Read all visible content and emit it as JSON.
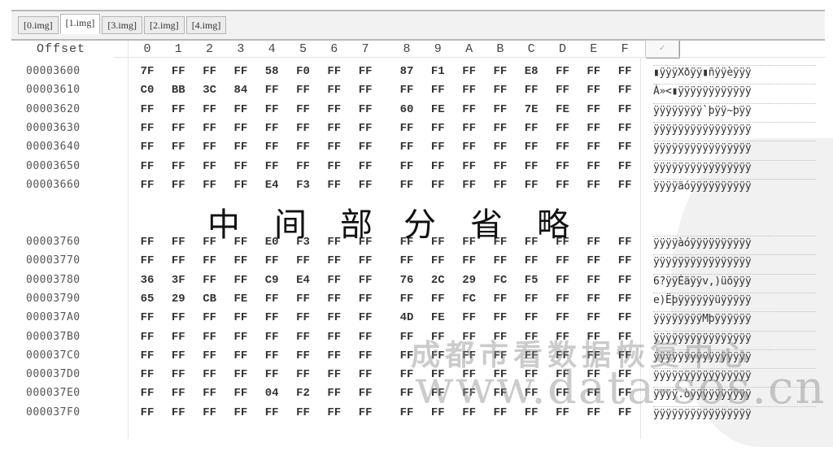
{
  "tabs": [
    {
      "label": "[0.img]",
      "active": false
    },
    {
      "label": "[1.img]",
      "active": true
    },
    {
      "label": "[3.img]",
      "active": false
    },
    {
      "label": "[2.img]",
      "active": false
    },
    {
      "label": "[4.img]",
      "active": false
    }
  ],
  "header": {
    "offset_label": "Offset",
    "columns": [
      "0",
      "1",
      "2",
      "3",
      "4",
      "5",
      "6",
      "7",
      "8",
      "9",
      "A",
      "B",
      "C",
      "D",
      "E",
      "F"
    ],
    "corner_button": "✓"
  },
  "rows_top": [
    {
      "offset": "00003600",
      "bytes": [
        "7F",
        "FF",
        "FF",
        "FF",
        "58",
        "F0",
        "FF",
        "FF",
        "87",
        "F1",
        "FF",
        "FF",
        "E8",
        "FF",
        "FF",
        "FF"
      ],
      "ascii": "▮ÿÿÿXðÿÿ▮ñÿÿèÿÿÿ"
    },
    {
      "offset": "00003610",
      "bytes": [
        "C0",
        "BB",
        "3C",
        "84",
        "FF",
        "FF",
        "FF",
        "FF",
        "FF",
        "FF",
        "FF",
        "FF",
        "FF",
        "FF",
        "FF",
        "FF"
      ],
      "ascii": "À»<▮ÿÿÿÿÿÿÿÿÿÿÿÿ"
    },
    {
      "offset": "00003620",
      "bytes": [
        "FF",
        "FF",
        "FF",
        "FF",
        "FF",
        "FF",
        "FF",
        "FF",
        "60",
        "FE",
        "FF",
        "FF",
        "7E",
        "FE",
        "FF",
        "FF"
      ],
      "ascii": "ÿÿÿÿÿÿÿÿ`þÿÿ~þÿÿ"
    },
    {
      "offset": "00003630",
      "bytes": [
        "FF",
        "FF",
        "FF",
        "FF",
        "FF",
        "FF",
        "FF",
        "FF",
        "FF",
        "FF",
        "FF",
        "FF",
        "FF",
        "FF",
        "FF",
        "FF"
      ],
      "ascii": "ÿÿÿÿÿÿÿÿÿÿÿÿÿÿÿÿ"
    },
    {
      "offset": "00003640",
      "bytes": [
        "FF",
        "FF",
        "FF",
        "FF",
        "FF",
        "FF",
        "FF",
        "FF",
        "FF",
        "FF",
        "FF",
        "FF",
        "FF",
        "FF",
        "FF",
        "FF"
      ],
      "ascii": "ÿÿÿÿÿÿÿÿÿÿÿÿÿÿÿÿ"
    },
    {
      "offset": "00003650",
      "bytes": [
        "FF",
        "FF",
        "FF",
        "FF",
        "FF",
        "FF",
        "FF",
        "FF",
        "FF",
        "FF",
        "FF",
        "FF",
        "FF",
        "FF",
        "FF",
        "FF"
      ],
      "ascii": "ÿÿÿÿÿÿÿÿÿÿÿÿÿÿÿÿ"
    },
    {
      "offset": "00003660",
      "bytes": [
        "FF",
        "FF",
        "FF",
        "FF",
        "E4",
        "F3",
        "FF",
        "FF",
        "FF",
        "FF",
        "FF",
        "FF",
        "FF",
        "FF",
        "FF",
        "FF"
      ],
      "ascii": "ÿÿÿÿäóÿÿÿÿÿÿÿÿÿÿ"
    }
  ],
  "omitted_note": [
    "中",
    "间",
    "部",
    "分",
    "省",
    "略"
  ],
  "rows_bottom": [
    {
      "offset": "00003760",
      "bytes": [
        "FF",
        "FF",
        "FF",
        "FF",
        "E0",
        "F3",
        "FF",
        "FF",
        "FF",
        "FF",
        "FF",
        "FF",
        "FF",
        "FF",
        "FF",
        "FF"
      ],
      "ascii": "ÿÿÿÿàóÿÿÿÿÿÿÿÿÿÿ"
    },
    {
      "offset": "00003770",
      "bytes": [
        "FF",
        "FF",
        "FF",
        "FF",
        "FF",
        "FF",
        "FF",
        "FF",
        "FF",
        "FF",
        "FF",
        "FF",
        "FF",
        "FF",
        "FF",
        "FF"
      ],
      "ascii": "ÿÿÿÿÿÿÿÿÿÿÿÿÿÿÿÿ"
    },
    {
      "offset": "00003780",
      "bytes": [
        "36",
        "3F",
        "FF",
        "FF",
        "C9",
        "E4",
        "FF",
        "FF",
        "76",
        "2C",
        "29",
        "FC",
        "F5",
        "FF",
        "FF",
        "FF"
      ],
      "ascii": "6?ÿÿÉäÿÿv,)üõÿÿÿ"
    },
    {
      "offset": "00003790",
      "bytes": [
        "65",
        "29",
        "CB",
        "FE",
        "FF",
        "FF",
        "FF",
        "FF",
        "FF",
        "FF",
        "FC",
        "FF",
        "FF",
        "FF",
        "FF",
        "FF"
      ],
      "ascii": "e)Ëþÿÿÿÿÿÿüÿÿÿÿÿ"
    },
    {
      "offset": "000037A0",
      "bytes": [
        "FF",
        "FF",
        "FF",
        "FF",
        "FF",
        "FF",
        "FF",
        "FF",
        "4D",
        "FE",
        "FF",
        "FF",
        "FF",
        "FF",
        "FF",
        "FF"
      ],
      "ascii": "ÿÿÿÿÿÿÿÿMþÿÿÿÿÿÿ"
    },
    {
      "offset": "000037B0",
      "bytes": [
        "FF",
        "FF",
        "FF",
        "FF",
        "FF",
        "FF",
        "FF",
        "FF",
        "FF",
        "FF",
        "FF",
        "FF",
        "FF",
        "FF",
        "FF",
        "FF"
      ],
      "ascii": "ÿÿÿÿÿÿÿÿÿÿÿÿÿÿÿÿ"
    },
    {
      "offset": "000037C0",
      "bytes": [
        "FF",
        "FF",
        "FF",
        "FF",
        "FF",
        "FF",
        "FF",
        "FF",
        "FF",
        "FF",
        "FF",
        "FF",
        "FF",
        "FF",
        "FF",
        "FF"
      ],
      "ascii": "ÿÿÿÿÿÿÿÿÿÿÿÿÿÿÿÿ"
    },
    {
      "offset": "000037D0",
      "bytes": [
        "FF",
        "FF",
        "FF",
        "FF",
        "FF",
        "FF",
        "FF",
        "FF",
        "FF",
        "FF",
        "FF",
        "FF",
        "FF",
        "FF",
        "FF",
        "FF"
      ],
      "ascii": "ÿÿÿÿÿÿÿÿÿÿÿÿÿÿÿÿ"
    },
    {
      "offset": "000037E0",
      "bytes": [
        "FF",
        "FF",
        "FF",
        "FF",
        "04",
        "F2",
        "FF",
        "FF",
        "FF",
        "FF",
        "FF",
        "FF",
        "FF",
        "FF",
        "FF",
        "FF"
      ],
      "ascii": "ÿÿÿÿ.òÿÿÿÿÿÿÿÿÿÿ"
    },
    {
      "offset": "000037F0",
      "bytes": [
        "FF",
        "FF",
        "FF",
        "FF",
        "FF",
        "FF",
        "FF",
        "FF",
        "FF",
        "FF",
        "FF",
        "FF",
        "FF",
        "FF",
        "FF",
        "FF"
      ],
      "ascii": "ÿÿÿÿÿÿÿÿÿÿÿÿÿÿÿÿ"
    }
  ],
  "watermark": {
    "line1": "成都市看数据恢复中心",
    "line2": "www.data-sos.cn"
  }
}
